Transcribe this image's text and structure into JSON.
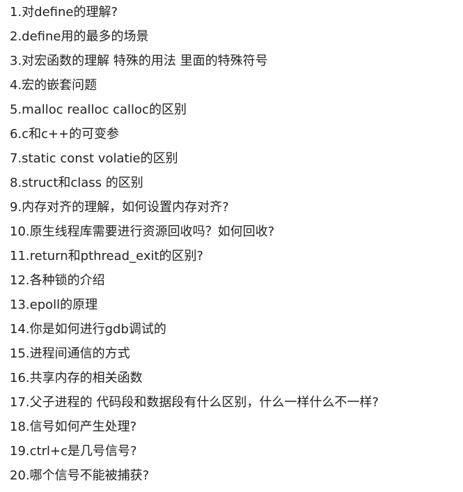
{
  "questions": [
    "1.对define的理解?",
    "2.define用的最多的场景",
    "3.对宏函数的理解 特殊的用法 里面的特殊符号",
    "4.宏的嵌套问题",
    "5.malloc realloc calloc的区别",
    "6.c和c++的可变参",
    "7.static const volatie的区别",
    "8.struct和class 的区别",
    "9.内存对齐的理解，如何设置内存对齐?",
    "10.原生线程库需要进行资源回收吗？如何回收?",
    "11.return和pthread_exit的区别?",
    "12.各种锁的介绍",
    "13.epoll的原理",
    "14.你是如何进行gdb调试的",
    "15.进程间通信的方式",
    "16.共享内存的相关函数",
    "17.父子进程的 代码段和数据段有什么区别，什么一样什么不一样?",
    "18.信号如何产生处理?",
    "19.ctrl+c是几号信号?",
    "20.哪个信号不能被捕获?"
  ]
}
